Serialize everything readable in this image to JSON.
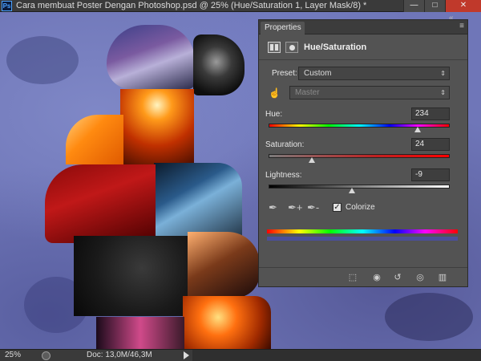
{
  "window": {
    "app_icon": "Ps",
    "title": "Cara membuat Poster Dengan Photoshop.psd @ 25% (Hue/Saturation 1, Layer Mask/8) *",
    "controls": {
      "minimize": "—",
      "maximize": "□",
      "close": "✕"
    }
  },
  "panel": {
    "tab_label": "Properties",
    "menu_icon": "≡",
    "collapse_icon": "«",
    "adjustment_title": "Hue/Saturation",
    "preset_label": "Preset:",
    "preset_value": "Custom",
    "channel_value": "Master",
    "hue": {
      "label": "Hue:",
      "value": "234"
    },
    "saturation": {
      "label": "Saturation:",
      "value": "24"
    },
    "lightness": {
      "label": "Lightness:",
      "value": "-9"
    },
    "colorize_label": "Colorize",
    "colorize_checked": true,
    "slider_levels": {
      "hue_fraction": 0.825,
      "saturation_fraction": 0.24,
      "lightness_fraction": 0.46
    },
    "colors": {
      "hue_bar_adjusted": "#4a4f9a",
      "panel_bg": "#535353"
    }
  },
  "icons": {
    "hand": "☝",
    "eyedropper": "✒",
    "eyedropper_plus": "✒+",
    "eyedropper_minus": "✒-",
    "dropdown_arrow": "⇕",
    "check": "✓",
    "footer": [
      "clip-to-layer-icon",
      "view-previous-icon",
      "reset-icon",
      "visibility-eye-icon",
      "trash-icon"
    ]
  },
  "status": {
    "zoom": "25%",
    "doc_info": "Doc: 13,0M/46,3M"
  }
}
